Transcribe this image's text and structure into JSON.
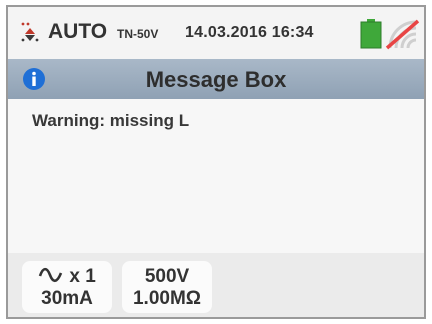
{
  "status_bar": {
    "mode": "AUTO",
    "system": "TN-50V",
    "datetime": "14.03.2016 16:34",
    "battery_icon": "battery-full-icon",
    "signal_icon": "wireless-disabled-icon",
    "battery_color": "#3fa83a",
    "signal_slash_color": "#e84545"
  },
  "title_bar": {
    "icon": "info-icon",
    "title": "Message Box"
  },
  "message": {
    "text": "Warning: missing L"
  },
  "parameters": {
    "current": {
      "icon": "ac-wave-icon",
      "multiplier": "x 1",
      "value": "30mA"
    },
    "insulation": {
      "voltage": "500V",
      "resistance": "1.00MΩ"
    }
  }
}
